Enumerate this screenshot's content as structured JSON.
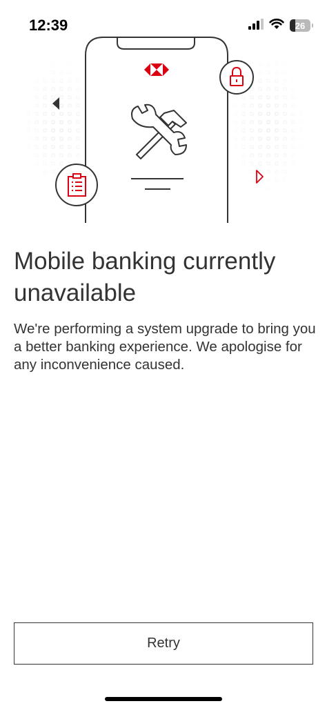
{
  "status_bar": {
    "time": "12:39",
    "battery_percent": "26",
    "battery_level": 0.26,
    "icons": [
      "cellular-signal-icon",
      "wifi-icon",
      "battery-icon"
    ]
  },
  "illustration": {
    "icons": [
      "phone-outline",
      "hsbc-logo",
      "padlock-icon",
      "wrench-hammer-icon",
      "clipboard-icon",
      "arrow-left-icon",
      "arrow-right-icon"
    ],
    "accent_color": "#db0011",
    "line_color": "#333333"
  },
  "main": {
    "title": "Mobile banking currently unavailable",
    "description": "We're performing a system upgrade to bring you a better banking experience. We apologise for any inconvenience caused."
  },
  "actions": {
    "retry_label": "Retry"
  }
}
